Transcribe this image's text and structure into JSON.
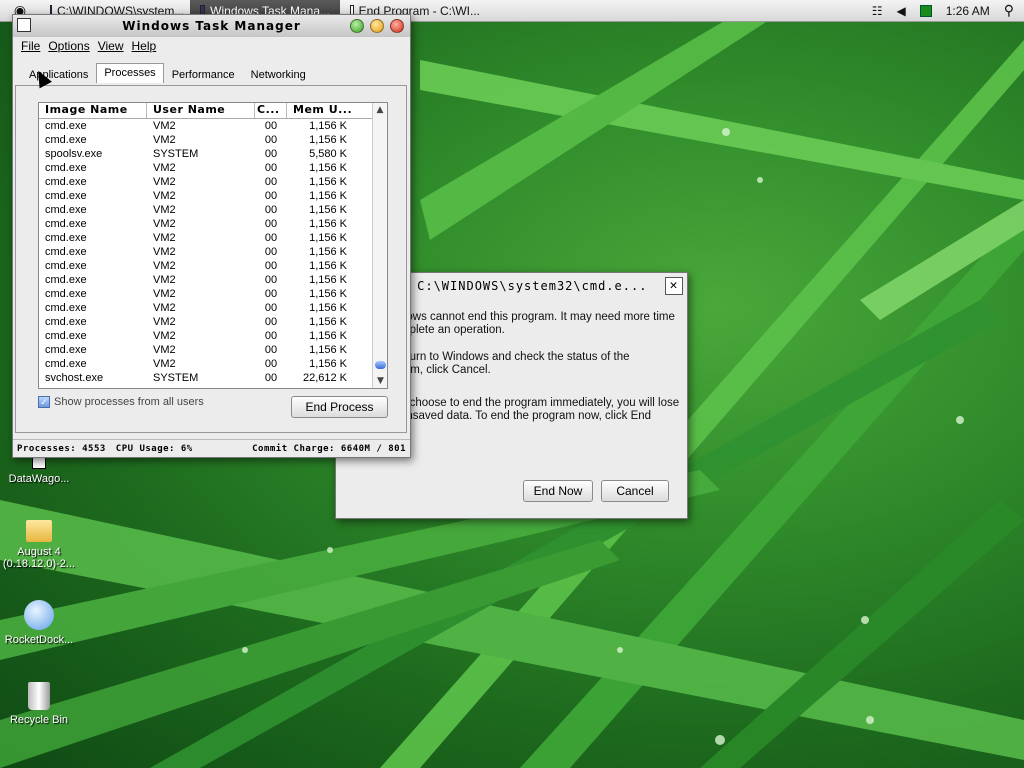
{
  "menubar": {
    "apple_icon": "apple-icon",
    "tabs": [
      {
        "label": "C:\\WINDOWS\\system..."
      },
      {
        "label": "Windows Task Mana..."
      },
      {
        "label": "End Program - C:\\WI..."
      }
    ],
    "clock": "1:26 AM"
  },
  "desktop_icons": [
    {
      "label": "DataWago..."
    },
    {
      "label": "August 4 (0.18.12.0)-2..."
    },
    {
      "label": "RocketDock..."
    },
    {
      "label": "Recycle Bin"
    }
  ],
  "task_manager": {
    "title": "Windows Task Manager",
    "menu": [
      "File",
      "Options",
      "View",
      "Help"
    ],
    "tabs": [
      "Applications",
      "Processes",
      "Performance",
      "Networking"
    ],
    "active_tab": "Processes",
    "columns": [
      "Image Name",
      "User Name",
      "C...",
      "Mem U..."
    ],
    "rows": [
      [
        "cmd.exe",
        "VM2",
        "00",
        "1,156 K"
      ],
      [
        "cmd.exe",
        "VM2",
        "00",
        "1,156 K"
      ],
      [
        "spoolsv.exe",
        "SYSTEM",
        "00",
        "5,580 K"
      ],
      [
        "cmd.exe",
        "VM2",
        "00",
        "1,156 K"
      ],
      [
        "cmd.exe",
        "VM2",
        "00",
        "1,156 K"
      ],
      [
        "cmd.exe",
        "VM2",
        "00",
        "1,156 K"
      ],
      [
        "cmd.exe",
        "VM2",
        "00",
        "1,156 K"
      ],
      [
        "cmd.exe",
        "VM2",
        "00",
        "1,156 K"
      ],
      [
        "cmd.exe",
        "VM2",
        "00",
        "1,156 K"
      ],
      [
        "cmd.exe",
        "VM2",
        "00",
        "1,156 K"
      ],
      [
        "cmd.exe",
        "VM2",
        "00",
        "1,156 K"
      ],
      [
        "cmd.exe",
        "VM2",
        "00",
        "1,156 K"
      ],
      [
        "cmd.exe",
        "VM2",
        "00",
        "1,156 K"
      ],
      [
        "cmd.exe",
        "VM2",
        "00",
        "1,156 K"
      ],
      [
        "cmd.exe",
        "VM2",
        "00",
        "1,156 K"
      ],
      [
        "cmd.exe",
        "VM2",
        "00",
        "1,156 K"
      ],
      [
        "cmd.exe",
        "VM2",
        "00",
        "1,156 K"
      ],
      [
        "cmd.exe",
        "VM2",
        "00",
        "1,156 K"
      ],
      [
        "svchost.exe",
        "SYSTEM",
        "00",
        "22,612 K"
      ]
    ],
    "show_all_label": "Show processes from all users",
    "show_all_checked": true,
    "end_process_label": "End Process",
    "status": {
      "processes": "Processes: 4553",
      "cpu": "CPU Usage: 6%",
      "commit": "Commit Charge: 6640M / 801"
    }
  },
  "end_dialog": {
    "title": "am - C:\\WINDOWS\\system32\\cmd.e...",
    "para1_line1": "dows cannot end this program. It may need more time",
    "para1_line2": "mplete an operation.",
    "para2_line1": "eturn to Windows and check the status of the",
    "para2_line2": "ram, click Cancel.",
    "para3_line1": "u choose to end the program immediately, you will lose",
    "para3_line2": "unsaved data. To end the program now, click End",
    "para3_line3": ".",
    "end_now_label": "End Now",
    "cancel_label": "Cancel"
  },
  "colors": {
    "grass_dark": "#0f4a14",
    "grass_light": "#4aa83a",
    "accent_blue": "#3a6ed8"
  }
}
